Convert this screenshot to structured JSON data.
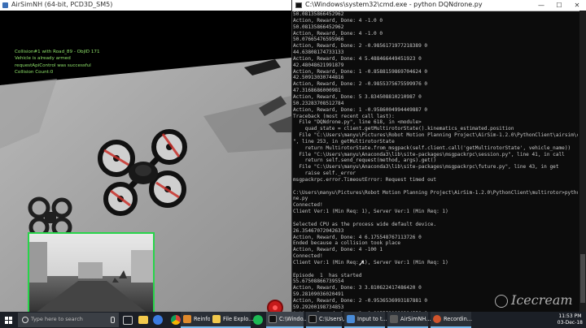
{
  "airsim_window": {
    "title": "AirSimNH (64-bit, PCD3D_SM5)",
    "status_lines": [
      "Collision#1 with Road_89 - ObjID 171",
      "Vehicle is already armed",
      "requestApiControl was successful",
      "Collision Count:0"
    ]
  },
  "cmd_window": {
    "title": "C:\\Windows\\system32\\cmd.exe - python  DQNdrone.py",
    "min_label": "—",
    "max_label": "☐",
    "close_label": "✕",
    "lines": [
      "50.08135866452962",
      "Action, Reward, Done: 4 -1.0 0",
      "50.08135866452962",
      "Action, Reward, Done: 4 -1.0 0",
      "50.07665476595966",
      "Action, Reward, Done: 2 -0.9856171977218389 0",
      "44.63808174733133",
      "Action, Reward, Done: 4 5.488466449451923 0",
      "42.48048621991879",
      "Action, Reward, Done: 1 -0.8588159869704624 0",
      "42.50913030744816",
      "Action, Reward, Done: 2 -0.9855375675599976 0",
      "47.3168686000981",
      "Action, Reward, Done: 5 3.834508810210987 0",
      "50.23283708512784",
      "Action, Reward, Done: 1 -0.9586004994449887 0",
      "Traceback (most recent call last):",
      "  File \"DQNdrone.py\", line 618, in <module>",
      "    quad_state = client.getMultirotorState().kinematics_estimated.position",
      "  File \"C:\\Users\\manyu\\Pictures\\Robot Motion Planning Project\\AirSim-1.2.0\\PythonClient\\airsim\\client.py",
      "\", line 253, in getMultirotorState",
      "    return MultirotorState.from_msgpack(self.client.call('getMultirotorState', vehicle_name))",
      "  File \"C:\\Users\\manyu\\Anaconda3\\lib\\site-packages\\msgpackrpc\\session.py\", line 41, in call",
      "    return self.send_request(method, args).get()",
      "  File \"C:\\Users\\manyu\\Anaconda3\\lib\\site-packages\\msgpackrpc\\future.py\", line 43, in get",
      "    raise self._error",
      "msgpackrpc.error.TimeoutError: Request timed out",
      "",
      "C:\\Users\\manyu\\Pictures\\Robot Motion Planning Project\\AirSim-1.2.0\\PythonClient\\multirotor>python DQNdro",
      "ne.py",
      "Connected!",
      "Client Ver:1 (Min Req: 1), Server Ver:1 (Min Req: 1)",
      "",
      "Selected CPU as the process wide default device.",
      "26.35467072042633",
      "Action, Reward, Done: 4 6.175548767113726 0",
      "Ended because a collision took place",
      "Action, Reward, Done: 4 -100 1",
      "Connected!",
      "Client Ver:1 (Min Req: 1), Server Ver:1 (Min Req: 1)",
      "",
      "Episode  1  has started",
      "55.67508866739554",
      "Action, Reward, Done: 3 3.810622417486420 0",
      "59.28109036020491",
      "Action, Reward, Done: 2 -0.9536536993187881 0",
      "59.29200198734853",
      "Action, Reward, Done: 2 -0.9855521889384558 0"
    ]
  },
  "taskbar": {
    "search_placeholder": "Type here to search",
    "apps": [
      {
        "label": "Reinforce...",
        "color": "#e08a2c"
      },
      {
        "label": "File Explo...",
        "color": "#f2c94c"
      },
      {
        "label": "C:\\Windo...",
        "color": "#1e1e1e"
      },
      {
        "label": "C:\\Users\\...",
        "color": "#1e1e1e"
      },
      {
        "label": "Input to t...",
        "color": "#4a8cd8"
      },
      {
        "label": "AirSimNH...",
        "color": "#5a5a5a"
      },
      {
        "label": "Recordin...",
        "color": "#d0542c"
      }
    ],
    "pinned_icons": [
      "task-view-icon",
      "explorer-icon",
      "chrome-icon",
      "spotify-icon",
      "notepad-icon"
    ],
    "time": "11:53 PM",
    "date": "03-Dec-18"
  },
  "watermark": "Icecream",
  "colors": {
    "status_text": "#8fe36a",
    "subcam_border": "#28d44a",
    "taskbar_bg": "#1b1f26",
    "taskbar_active": "#76b9ed",
    "record_button": "#c41a1a"
  }
}
